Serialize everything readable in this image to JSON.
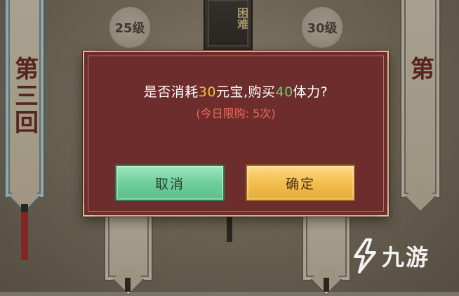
{
  "banners": {
    "left": {
      "text": "第三回"
    },
    "center": {
      "text": "困难"
    },
    "right": {
      "text": "第"
    }
  },
  "levels": {
    "left": "25级",
    "right": "30级"
  },
  "dialog": {
    "question_prefix": "是否消耗",
    "yuanbao_amount": "30",
    "question_mid": "元宝,购买",
    "stamina_amount": "40",
    "question_suffix": "体力?",
    "purchase_limit": "(今日限购: 5次)",
    "cancel_label": "取消",
    "confirm_label": "确定"
  },
  "watermark": {
    "text": "九游"
  },
  "colors": {
    "yuanbao": "#f2c23c",
    "stamina": "#5fd77a",
    "limit": "#f06a5a",
    "dialog_bg": "#6c2d2c"
  }
}
